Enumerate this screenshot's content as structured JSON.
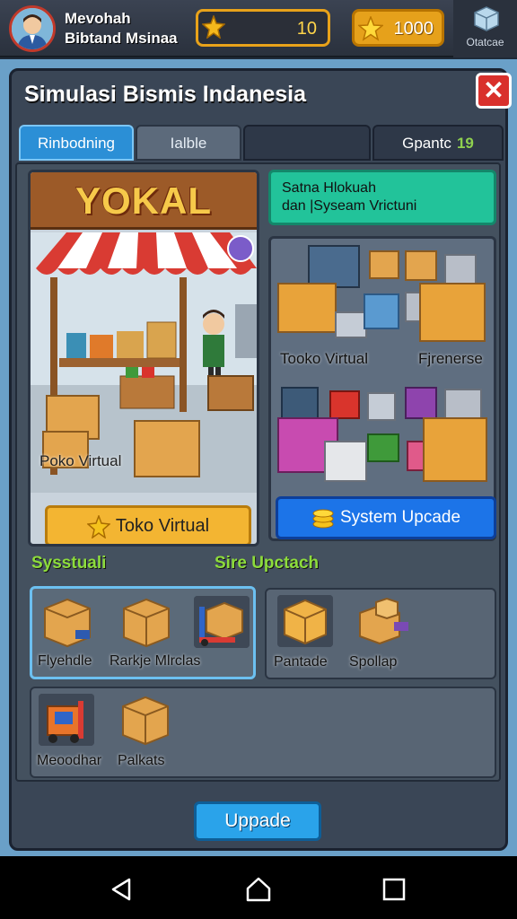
{
  "topbar": {
    "player_name_line1": "Mevohah",
    "player_name_line2": "Bibtand Msinaa",
    "coins": "10",
    "stars": "1000",
    "settings_label": "Otatcae"
  },
  "panel": {
    "title": "Simulasi Bismis Indanesia",
    "close_label": "✕"
  },
  "tabs": [
    {
      "label": "Rinbodning",
      "state": "active"
    },
    {
      "label": "Ialble",
      "state": "normal"
    },
    {
      "label": "",
      "state": "dark"
    },
    {
      "label": "Gpantc",
      "count": "19",
      "state": "dark"
    }
  ],
  "shop": {
    "banner": "YOKAL",
    "caption": "Poko Virtual",
    "button_label": "Toko Virtual"
  },
  "upgrade": {
    "header_line1": "Satna Hlokuah",
    "header_line2": "dan |Syseam Vrictuni",
    "label_left": "Tooko Virtual",
    "label_right": "Fjrenerse",
    "button_label": "System Upcade"
  },
  "sections": {
    "left_label": "Sysstuali",
    "right_label": "Sire Upctach"
  },
  "inventory_left_labels": [
    "Flyehdle",
    "Rarkje Mlrclas"
  ],
  "inventory_right_labels": [
    "Pantade",
    "Spollap"
  ],
  "inventory_bottom_labels": [
    "Meoodhar",
    "Palkats"
  ],
  "footer": {
    "button_label": "Uppade"
  },
  "colors": {
    "accent_blue": "#2b8fd6",
    "gold": "#f3b532",
    "green_text": "#8ddc3c",
    "close_red": "#d9302c",
    "teal_header": "#22c39a"
  }
}
